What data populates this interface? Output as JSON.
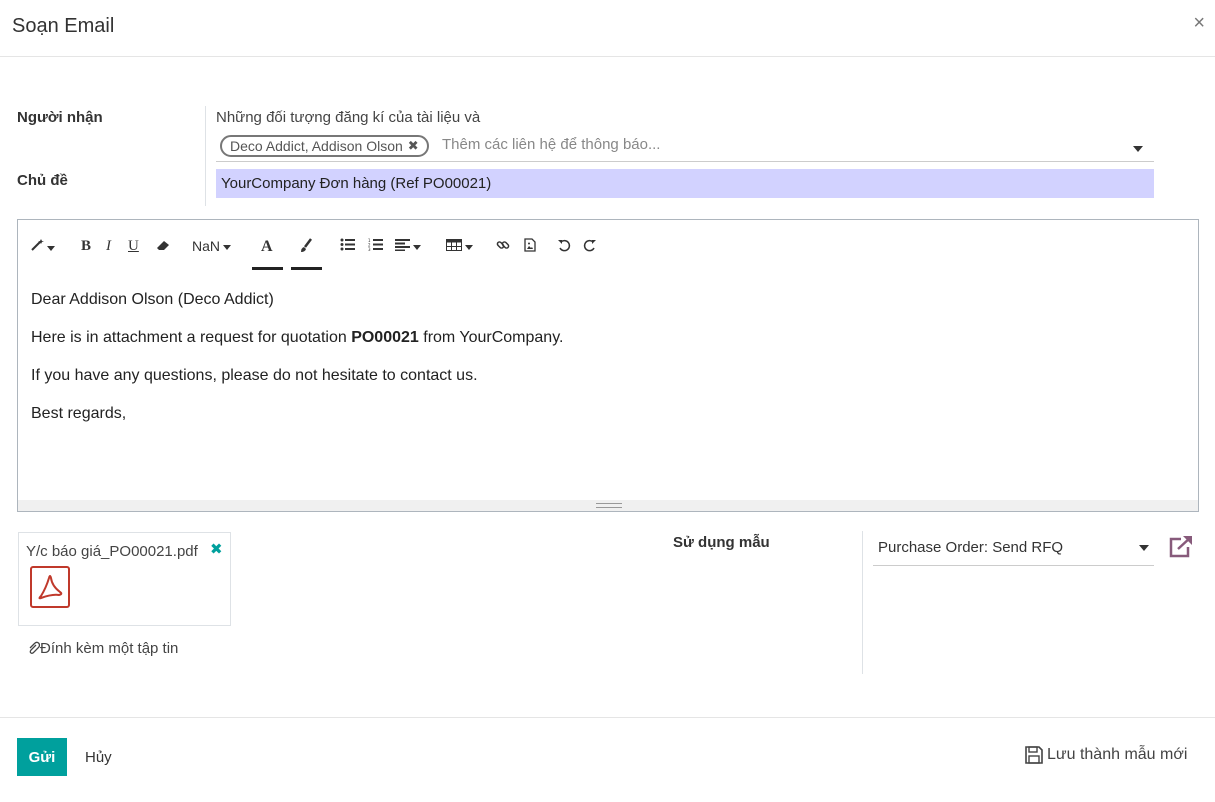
{
  "dialog": {
    "title": "Soạn Email",
    "close_glyph": "×"
  },
  "form": {
    "recipients_label": "Người nhận",
    "recipients_note": "Những đối tượng đăng kí của tài liệu và",
    "recipient_tag": "Deco Addict, Addison Olson",
    "recipient_tag_remove": "✖",
    "recipients_placeholder": "Thêm các liên hệ để thông báo...",
    "subject_label": "Chủ đề",
    "subject_value": "YourCompany Đơn hàng (Ref PO00021)"
  },
  "toolbar": {
    "magic": "magic-wand-icon",
    "bold": "B",
    "italic": "I",
    "underline": "U",
    "eraser": "eraser-icon",
    "font_size": "NaN",
    "font_color": "A",
    "bg_color": "brush-icon",
    "list_ul": "unordered-list-icon",
    "list_ol": "ordered-list-icon",
    "align": "align-left-icon",
    "table": "table-icon",
    "link": "link-icon",
    "image": "image-icon",
    "undo": "undo-icon",
    "redo": "redo-icon"
  },
  "body": {
    "greeting": "Dear Addison Olson (Deco Addict)",
    "line2_pre": "Here is in attachment a request for quotation ",
    "line2_bold": "PO00021",
    "line2_post": " from YourCompany.",
    "line3": "If you have any questions, please do not hesitate to contact us.",
    "line4": "Best regards,"
  },
  "attachments": {
    "file_name": "Y/c báo giá_PO00021.pdf",
    "remove_glyph": "✖",
    "attach_link": "Đính kèm một tập tin"
  },
  "template": {
    "label": "Sử dụng mẫu",
    "selected": "Purchase Order: Send RFQ"
  },
  "footer": {
    "send": "Gửi",
    "cancel": "Hủy",
    "save_template": "Lưu thành mẫu mới"
  },
  "colors": {
    "accent": "#00a09d",
    "subject_bg": "#d2d2ff",
    "link_purple": "#875a7b"
  }
}
